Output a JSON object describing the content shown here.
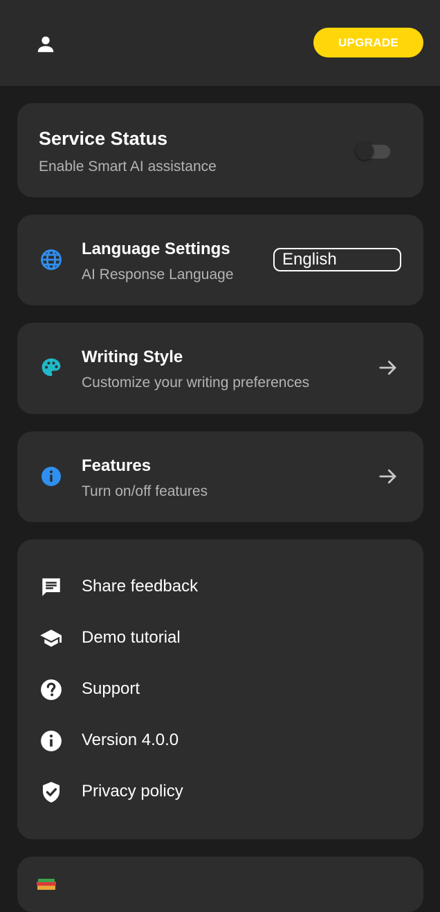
{
  "header": {
    "profile_icon": "person-icon",
    "upgrade_label": "UPGRADE",
    "upgrade_color": "#ffd60a"
  },
  "service_status": {
    "title": "Service Status",
    "subtitle": "Enable Smart AI assistance",
    "enabled": false
  },
  "language_settings": {
    "icon": "globe-icon",
    "title": "Language Settings",
    "subtitle": "AI Response Language",
    "selected": "English"
  },
  "writing_style": {
    "icon": "palette-icon",
    "title": "Writing Style",
    "subtitle": "Customize your writing preferences"
  },
  "features": {
    "icon": "info-icon",
    "title": "Features",
    "subtitle": "Turn on/off features"
  },
  "menu": {
    "items": [
      {
        "icon": "feedback-icon",
        "label": "Share feedback"
      },
      {
        "icon": "graduation-cap-icon",
        "label": "Demo tutorial"
      },
      {
        "icon": "help-icon",
        "label": "Support"
      },
      {
        "icon": "info-icon",
        "label": "Version 4.0.0"
      },
      {
        "icon": "shield-check-icon",
        "label": "Privacy policy"
      }
    ]
  },
  "colors": {
    "accent_blue": "#2f8ff0",
    "accent_teal": "#1fb9c9",
    "background": "#1c1c1c",
    "card": "#2d2d2d"
  }
}
